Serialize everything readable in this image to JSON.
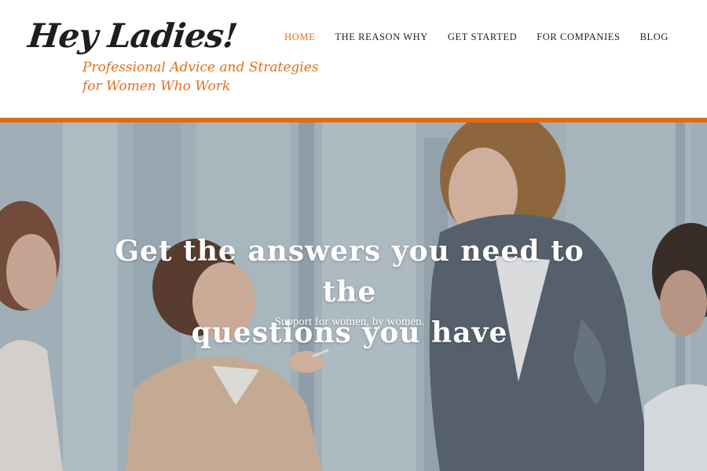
{
  "site": {
    "title": "Hey Ladies!",
    "tagline_line1": "Professional Advice and Strategies",
    "tagline_line2": "for Women Who Work"
  },
  "nav": {
    "items": [
      {
        "label": "HOME",
        "active": true
      },
      {
        "label": "THE REASON WHY",
        "active": false
      },
      {
        "label": "GET STARTED",
        "active": false
      },
      {
        "label": "FOR COMPANIES",
        "active": false
      },
      {
        "label": "BLOG",
        "active": false
      }
    ]
  },
  "hero": {
    "headline_line1": "Get the answers you need to the",
    "headline_line2": "questions you have",
    "subline": "Support for women, by women.",
    "image": "office-meeting-photo"
  },
  "colors": {
    "accent": "#e36c0f",
    "title": "#1e1e1e",
    "hero_text": "#ffffff"
  }
}
